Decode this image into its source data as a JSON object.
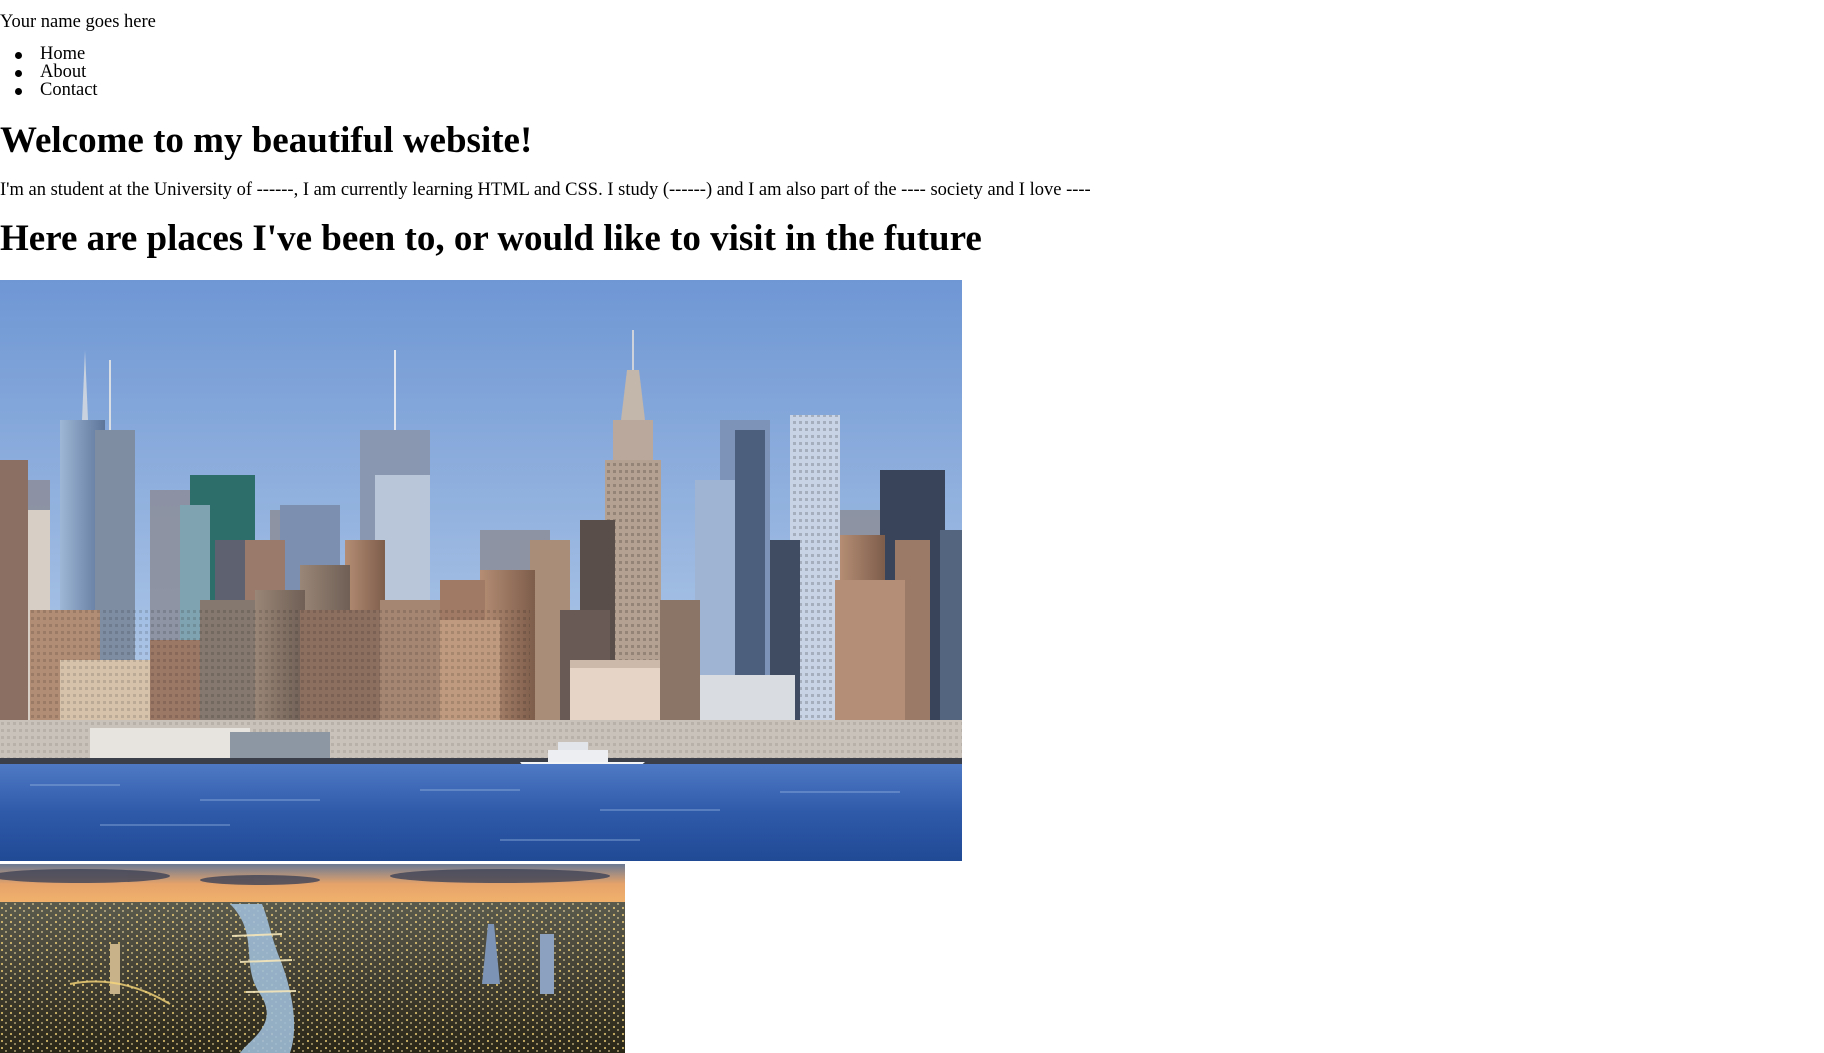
{
  "header": {
    "site_name": "Your name goes here"
  },
  "nav": {
    "items": [
      {
        "label": "Home"
      },
      {
        "label": "About"
      },
      {
        "label": "Contact"
      }
    ]
  },
  "main": {
    "heading": "Welcome to my beautiful website!",
    "intro": "I'm an student at the University of ------, I am currently learning HTML and CSS. I study (------) and I am also part of the ---- society and I love ----",
    "places_heading": "Here are places I've been to, or would like to visit in the future"
  },
  "images": [
    {
      "subject": "new-york-skyline-photo"
    },
    {
      "subject": "london-aerial-dusk-photo"
    }
  ]
}
